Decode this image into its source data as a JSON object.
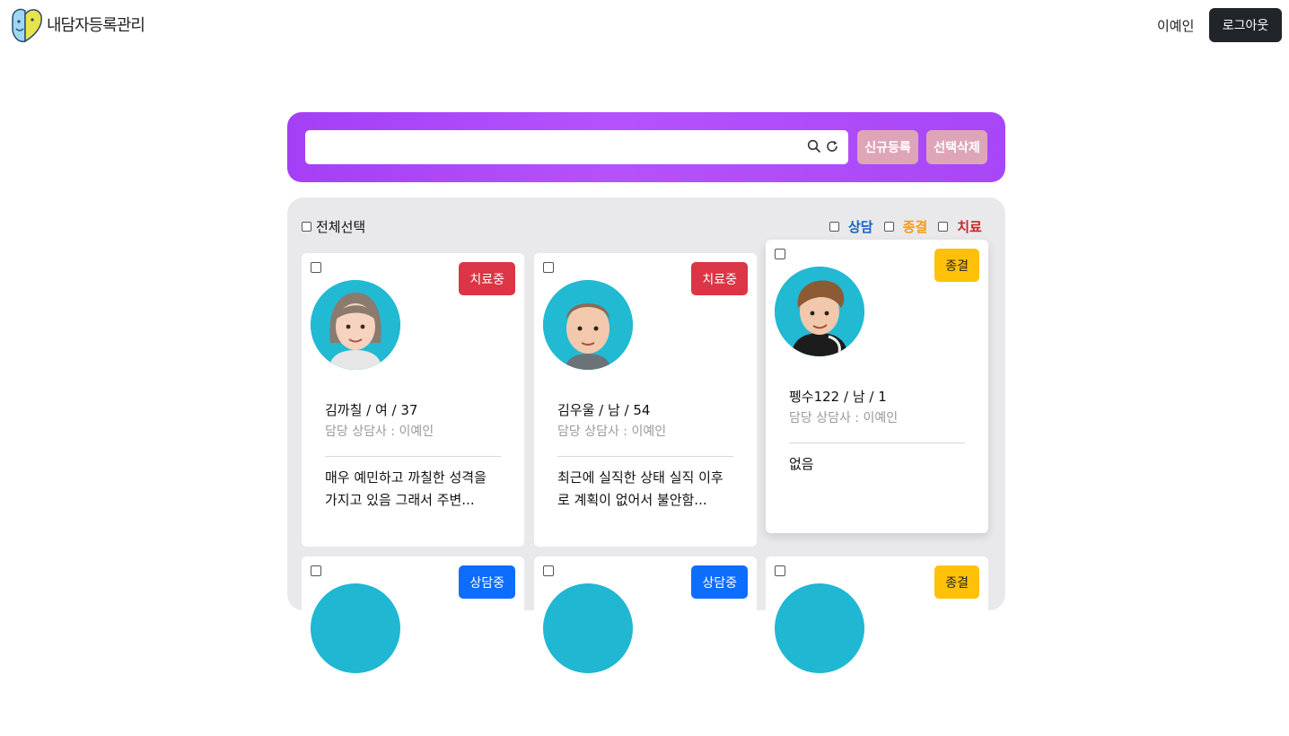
{
  "header": {
    "brand": "내담자등록관리",
    "user_name": "이예인",
    "logout_label": "로그아웃"
  },
  "search": {
    "value": "",
    "placeholder": "",
    "new_label": "신규등록",
    "delete_label": "선택삭제"
  },
  "list": {
    "select_all_label": "전체선택",
    "filters": [
      {
        "label": "상담",
        "color": "#1565c0"
      },
      {
        "label": "종결",
        "color": "#f39c12"
      },
      {
        "label": "치료",
        "color": "#c62828"
      }
    ],
    "cards": [
      {
        "status": "치료중",
        "name_line": "김까칠 / 여 / 37",
        "counselor": "담당 상담사 : 이예인",
        "memo": "매우 예민하고 까칠한 성격을 가지고 있음 그래서 주변..."
      },
      {
        "status": "치료중",
        "name_line": "김우울 / 남 / 54",
        "counselor": "담당 상담사 : 이예인",
        "memo": "최근에 실직한 상태 실직 이후로 계획이 없어서 불안함..."
      },
      {
        "status": "종결",
        "name_line": "펭수122 / 남 / 1",
        "counselor": "담당 상담사 : 이예인",
        "memo": "없음"
      },
      {
        "status": "상담중"
      },
      {
        "status": "상담중"
      },
      {
        "status": "종결"
      }
    ]
  },
  "colors": {
    "primary_gradient": "#a847f7",
    "treat": "#dc3545",
    "end": "#ffc107",
    "counsel": "#0d6efd"
  }
}
